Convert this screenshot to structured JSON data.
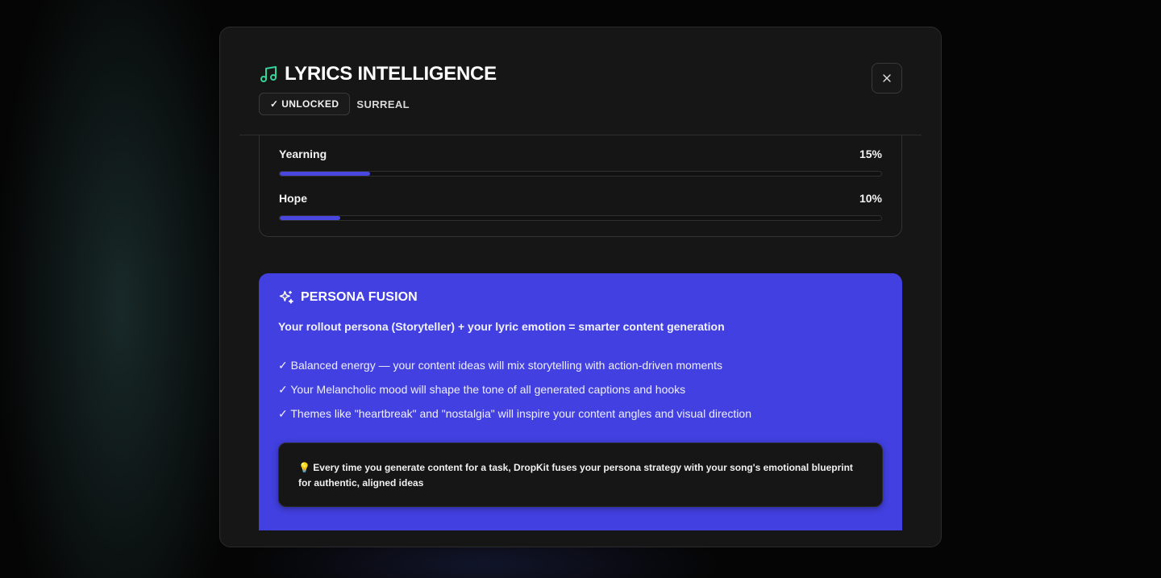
{
  "modal": {
    "title": "LYRICS INTELLIGENCE",
    "badge_unlocked": "✓ UNLOCKED",
    "badge_style": "SURREAL",
    "icon": "music-note-icon",
    "close_icon": "close-icon",
    "accent_color": "#34d399"
  },
  "emotions": [
    {
      "label": "Yearning",
      "percent_label": "15%",
      "value": 15
    },
    {
      "label": "Hope",
      "percent_label": "10%",
      "value": 10
    }
  ],
  "persona": {
    "icon": "sparkle-icon",
    "title": "PERSONA FUSION",
    "subtitle": "Your rollout persona (Storyteller) + your lyric emotion = smarter content generation",
    "points": [
      "✓ Balanced energy — your content ideas will mix storytelling with action-driven moments",
      "✓ Your Melancholic mood will shape the tone of all generated captions and hooks",
      "✓ Themes like \"heartbreak\" and \"nostalgia\" will inspire your content angles and visual direction"
    ],
    "tip": "💡 Every time you generate content for a task, DropKit fuses your persona strategy with your song's emotional blueprint for authentic, aligned ideas",
    "background_color": "#4240e0"
  }
}
